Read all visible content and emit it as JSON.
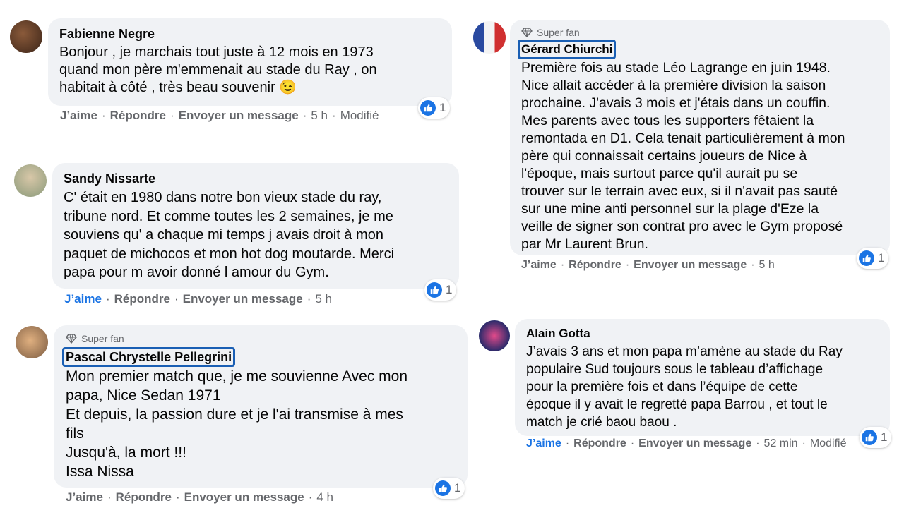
{
  "comments": [
    {
      "name": "Fabienne Negre",
      "text": "Bonjour , je marchais tout juste à 12 mois en 1973\nquand mon père m'emmenait au stade du Ray , on\nhabitait à côté , très beau souvenir 😉",
      "like": "J’aime",
      "reply": "Répondre",
      "message": "Envoyer un message",
      "time": "5 h",
      "edited": "Modifié",
      "reactions": "1"
    },
    {
      "name": "Sandy Nissarte",
      "text": "C' était en 1980 dans notre bon vieux stade du ray,\ntribune nord. Et comme toutes les 2 semaines, je me\nsouviens qu' a chaque mi temps j avais droit à mon\npaquet de michocos et mon hot dog moutarde. Merci\npapa pour m avoir donné l amour du Gym.",
      "like": "J’aime",
      "reply": "Répondre",
      "message": "Envoyer un message",
      "time": "5 h",
      "reactions": "1"
    },
    {
      "badge": "Super fan",
      "name": "Pascal Chrystelle Pellegrini",
      "text": "Mon premier match que, je me souvienne Avec mon\npapa, Nice Sedan 1971\nEt depuis, la passion dure et je l'ai transmise à mes\nfils\nJusqu'à, la mort !!!\nIssa Nissa",
      "like": "J’aime",
      "reply": "Répondre",
      "message": "Envoyer un message",
      "time": "4 h",
      "reactions": "1"
    },
    {
      "badge": "Super fan",
      "name": "Gérard Chiurchi",
      "text": "Première fois au stade Léo Lagrange en juin 1948.\nNice allait accéder à la première division la saison\nprochaine. J'avais 3 mois et j'étais dans un couffin.\nMes parents avec tous les supporters fêtaient la\nremontada en D1. Cela tenait particulièrement à mon\npère qui connaissait certains joueurs de Nice à\nl'époque, mais surtout parce qu'il aurait pu se\ntrouver sur le terrain avec eux, si il n'avait pas sauté\nsur une mine anti personnel sur la plage d'Eze la\nveille de signer son contrat pro avec le Gym proposé\npar Mr Laurent Brun.",
      "like": "J’aime",
      "reply": "Répondre",
      "message": "Envoyer un message",
      "time": "5 h",
      "reactions": "1"
    },
    {
      "name": "Alain Gotta",
      "text": "J’avais 3 ans et mon papa m’amène au stade du Ray\npopulaire Sud toujours sous le tableau d’affichage\npour la première fois et dans l’équipe de cette\népoque il y avait le regretté papa Barrou , et tout le\nmatch je crié baou baou .",
      "like": "J’aime",
      "reply": "Répondre",
      "message": "Envoyer un message",
      "time": "52 min",
      "edited": "Modifié",
      "reactions": "1"
    }
  ],
  "colors": {
    "bubble": "#f0f2f5",
    "accent": "#1b74e4",
    "secondary": "#65676b",
    "highlight_box": "#1a5fb4"
  },
  "icons": {
    "like_reaction": "thumbs-up-icon",
    "badge": "diamond-icon"
  }
}
